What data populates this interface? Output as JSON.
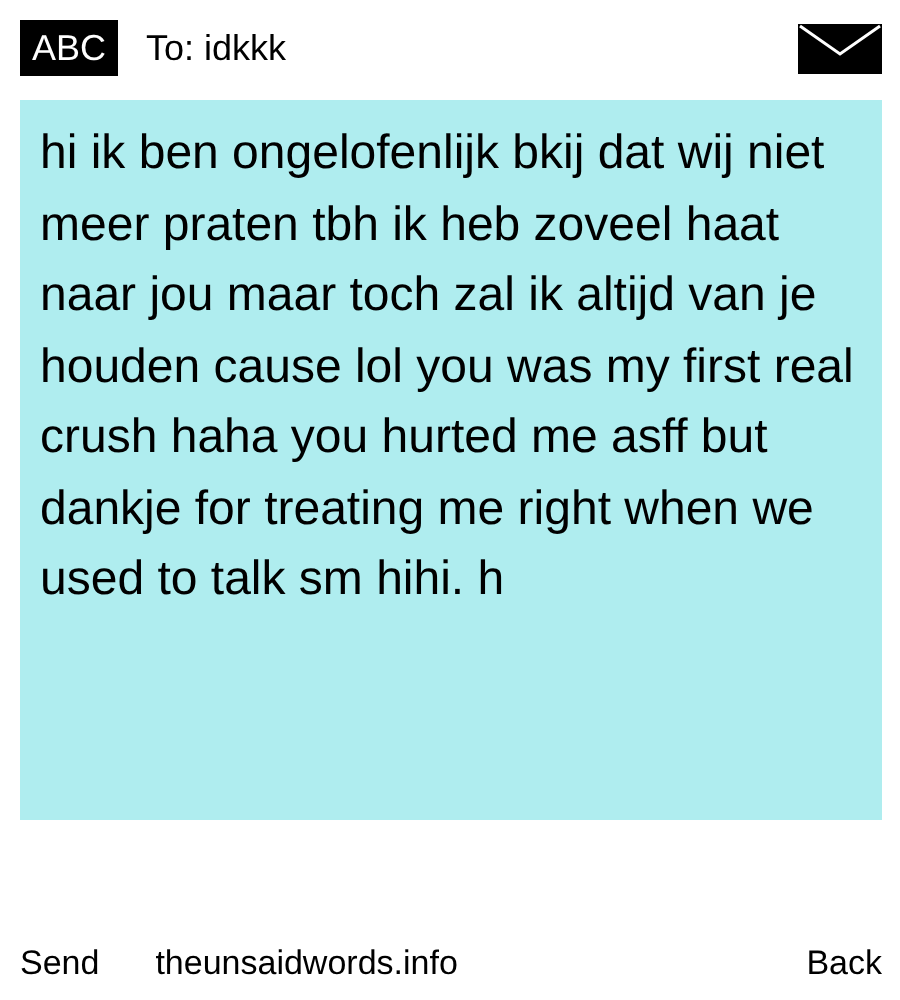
{
  "header": {
    "mode_badge": "ABC",
    "recipient": "To: idkkk"
  },
  "message": {
    "text": "hi ik ben ongelofenlijk bkij dat wij niet meer praten tbh ik heb zoveel haat naar jou maar toch zal ik altijd van je houden cause lol you was my first real crush haha you hurted me asff but dankje for treating me right when we used to talk sm hihi. h"
  },
  "footer": {
    "left": "Send",
    "center": "theunsaidwords.info",
    "right": "Back"
  }
}
